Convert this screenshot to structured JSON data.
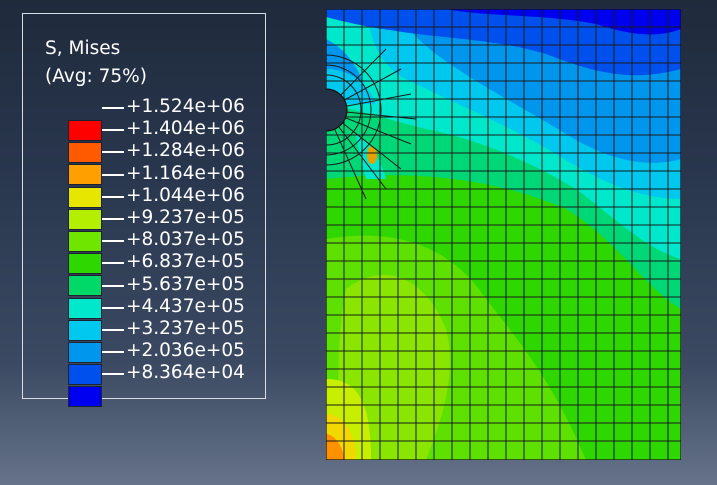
{
  "legend": {
    "title_line1": "S, Mises",
    "title_line2": "(Avg: 75%)",
    "values": [
      "+1.524e+06",
      "+1.404e+06",
      "+1.284e+06",
      "+1.164e+06",
      "+1.044e+06",
      "+9.237e+05",
      "+8.037e+05",
      "+6.837e+05",
      "+5.637e+05",
      "+4.437e+05",
      "+3.237e+05",
      "+2.036e+05",
      "+8.364e+04"
    ],
    "colors": [
      "#ff0000",
      "#ff5a00",
      "#ffa000",
      "#e6e600",
      "#b4ee00",
      "#6ee600",
      "#2ed700",
      "#00d868",
      "#00e8cc",
      "#00c8ee",
      "#0096ee",
      "#0050ee",
      "#0000f0"
    ]
  },
  "model": {
    "description_type": "contour-plot",
    "colors": {
      "mesh_line": "#1a1a1a",
      "background_plate": "#00d0a0"
    }
  }
}
